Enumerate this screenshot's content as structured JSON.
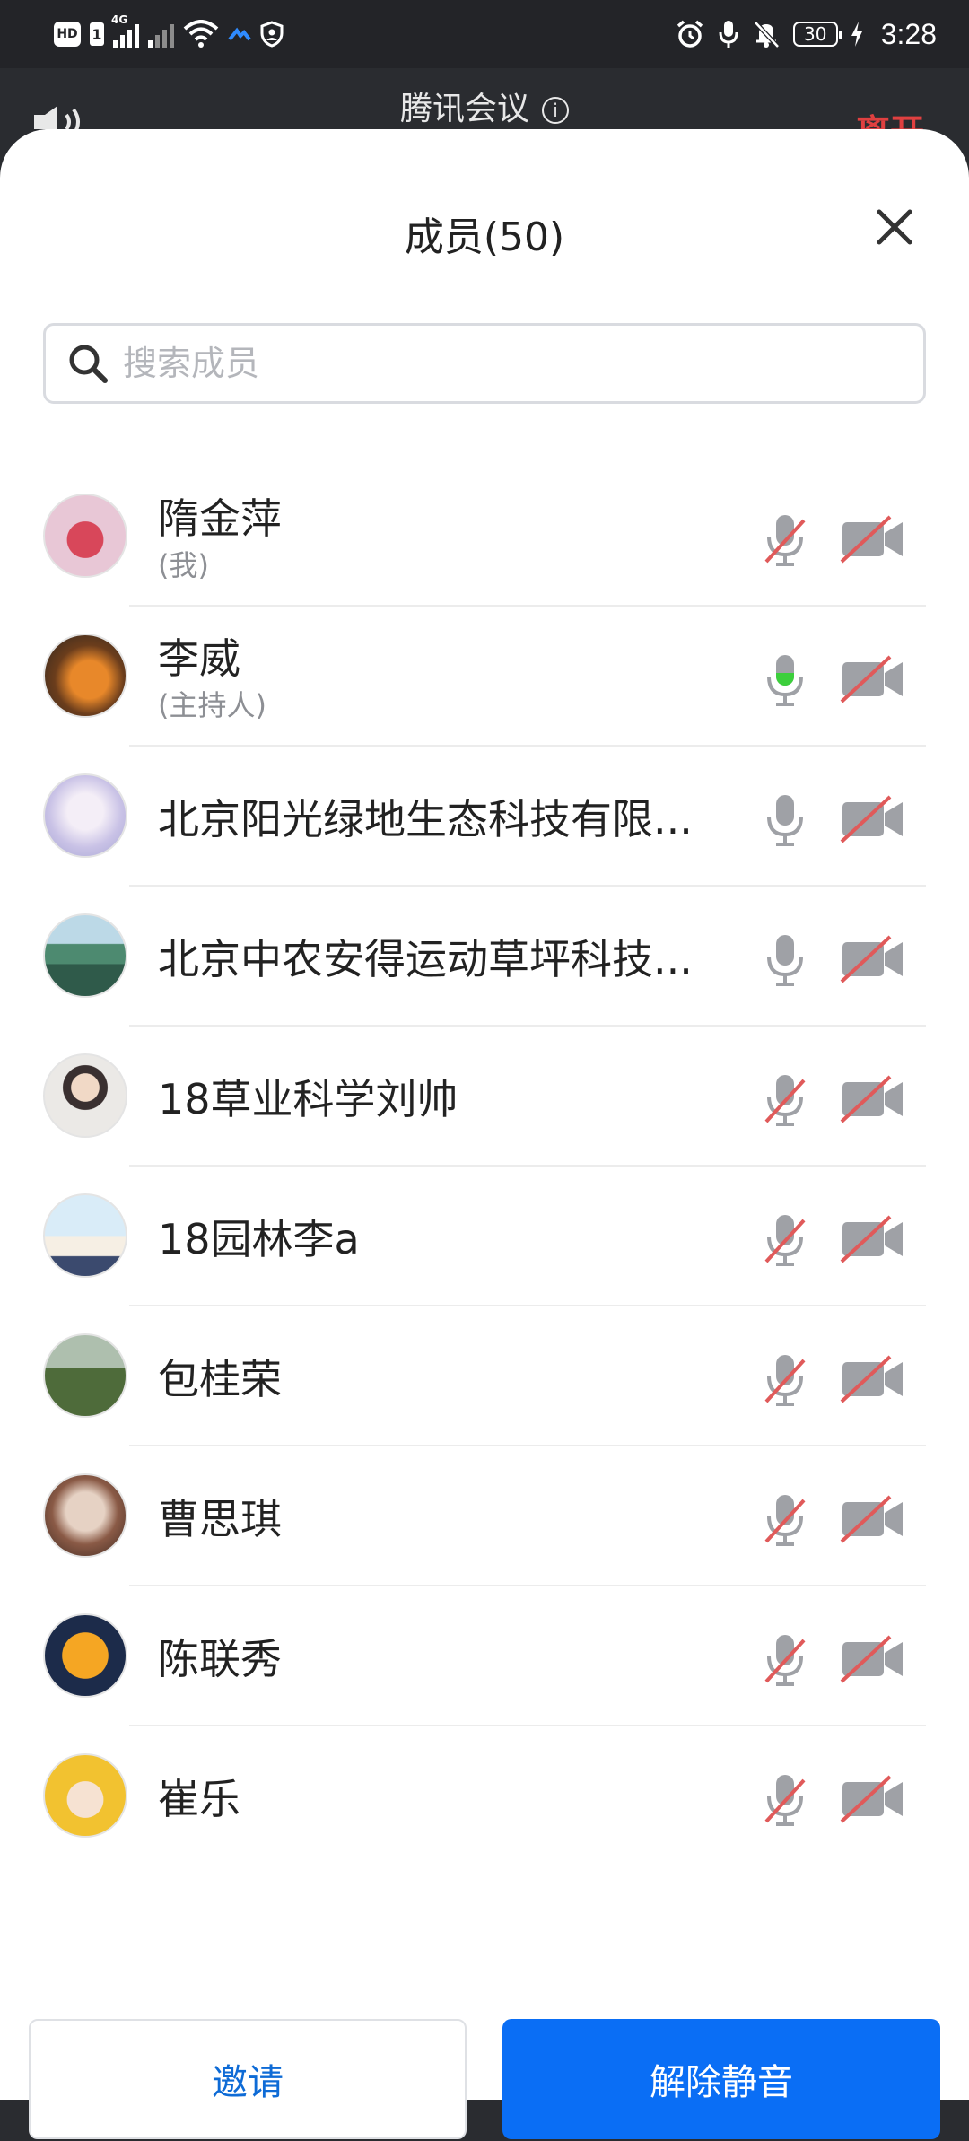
{
  "status_bar": {
    "hd": "HD",
    "sim": "1",
    "network": "4G",
    "battery": "30",
    "time": "3:28"
  },
  "app": {
    "title": "腾讯会议",
    "leave_label": "离开"
  },
  "sheet": {
    "title": "成员(50)"
  },
  "search": {
    "placeholder": "搜索成员"
  },
  "members": [
    {
      "name": "隋金萍",
      "role": "(我)",
      "mic": "muted",
      "camera": "off"
    },
    {
      "name": "李威",
      "role": "(主持人)",
      "mic": "speaking",
      "camera": "off"
    },
    {
      "name": "北京阳光绿地生态科技有限...",
      "role": "",
      "mic": "on",
      "camera": "off"
    },
    {
      "name": "北京中农安得运动草坪科技...",
      "role": "",
      "mic": "on",
      "camera": "off"
    },
    {
      "name": "18草业科学刘帅",
      "role": "",
      "mic": "muted",
      "camera": "off"
    },
    {
      "name": "18园林李a",
      "role": "",
      "mic": "muted",
      "camera": "off"
    },
    {
      "name": "包桂荣",
      "role": "",
      "mic": "muted",
      "camera": "off"
    },
    {
      "name": "曹思琪",
      "role": "",
      "mic": "muted",
      "camera": "off"
    },
    {
      "name": "陈联秀",
      "role": "",
      "mic": "muted",
      "camera": "off"
    },
    {
      "name": "崔乐",
      "role": "",
      "mic": "muted",
      "camera": "off"
    }
  ],
  "buttons": {
    "invite": "邀请",
    "unmute": "解除静音"
  },
  "colors": {
    "accent": "#0a6ef5",
    "muted_slash": "#e05a5a",
    "speaking": "#3ccf3c"
  }
}
